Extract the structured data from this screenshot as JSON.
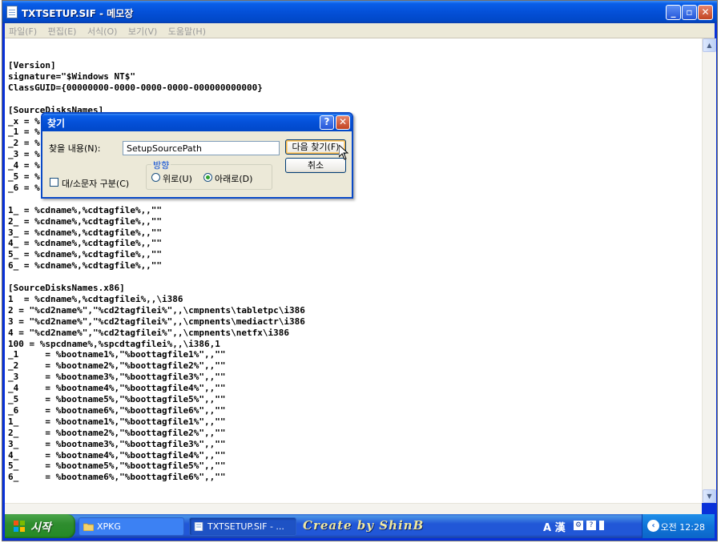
{
  "window": {
    "title": "TXTSETUP.SIF - 메모장"
  },
  "menu": [
    "파일(F)",
    "편집(E)",
    "서식(O)",
    "보기(V)",
    "도움말(H)"
  ],
  "text_lines": [
    "[Version]",
    "signature=\"$Windows NT$\"",
    "ClassGUID={00000000-0000-0000-0000-000000000000}",
    "",
    "[SourceDisksNames]",
    "_x = %",
    "_1 = %",
    "_2 = %",
    "_3 = %",
    "_4 = %",
    "_5 = %",
    "_6 = %",
    "",
    "1_ = %cdname%,%cdtagfile%,,\"\"",
    "2_ = %cdname%,%cdtagfile%,,\"\"",
    "3_ = %cdname%,%cdtagfile%,,\"\"",
    "4_ = %cdname%,%cdtagfile%,,\"\"",
    "5_ = %cdname%,%cdtagfile%,,\"\"",
    "6_ = %cdname%,%cdtagfile%,,\"\"",
    "",
    "[SourceDisksNames.x86]",
    "1  = %cdname%,%cdtagfilei%,,\\i386",
    "2 = \"%cd2name%\",\"%cd2tagfilei%\",,\\cmpnents\\tabletpc\\i386",
    "3 = \"%cd2name%\",\"%cd2tagfilei%\",,\\cmpnents\\mediactr\\i386",
    "4 = \"%cd2name%\",\"%cd2tagfilei%\",,\\cmpnents\\netfx\\i386",
    "100 = %spcdname%,%spcdtagfilei%,,\\i386,1",
    "_1     = %bootname1%,\"%boottagfile1%\",,\"\"",
    "_2     = %bootname2%,\"%boottagfile2%\",,\"\"",
    "_3     = %bootname3%,\"%boottagfile3%\",,\"\"",
    "_4     = %bootname4%,\"%boottagfile4%\",,\"\"",
    "_5     = %bootname5%,\"%boottagfile5%\",,\"\"",
    "_6     = %bootname6%,\"%boottagfile6%\",,\"\"",
    "1_     = %bootname1%,\"%boottagfile1%\",,\"\"",
    "2_     = %bootname2%,\"%boottagfile2%\",,\"\"",
    "3_     = %bootname3%,\"%boottagfile3%\",,\"\"",
    "4_     = %bootname4%,\"%boottagfile4%\",,\"\"",
    "5_     = %bootname5%,\"%boottagfile5%\",,\"\"",
    "6_     = %bootname6%,\"%boottagfile6%\",,\"\""
  ],
  "find_dialog": {
    "title": "찾기",
    "find_label": "찾을 내용(N):",
    "find_value": "SetupSourcePath",
    "find_next_label": "다음 찾기(F)",
    "cancel_label": "취소",
    "direction_label": "방향",
    "direction_up": "위로(U)",
    "direction_down": "아래로(D)",
    "direction_selected": "down",
    "match_case_label": "대/소문자 구분(C)",
    "match_case_checked": false
  },
  "taskbar": {
    "start_label": "시작",
    "tasks": [
      "XPKG",
      "TXTSETUP.SIF - ..."
    ],
    "active_task": 1,
    "brand": "Create by ShinB",
    "ime_label": "A 漢",
    "clock": "오전 12:28"
  }
}
